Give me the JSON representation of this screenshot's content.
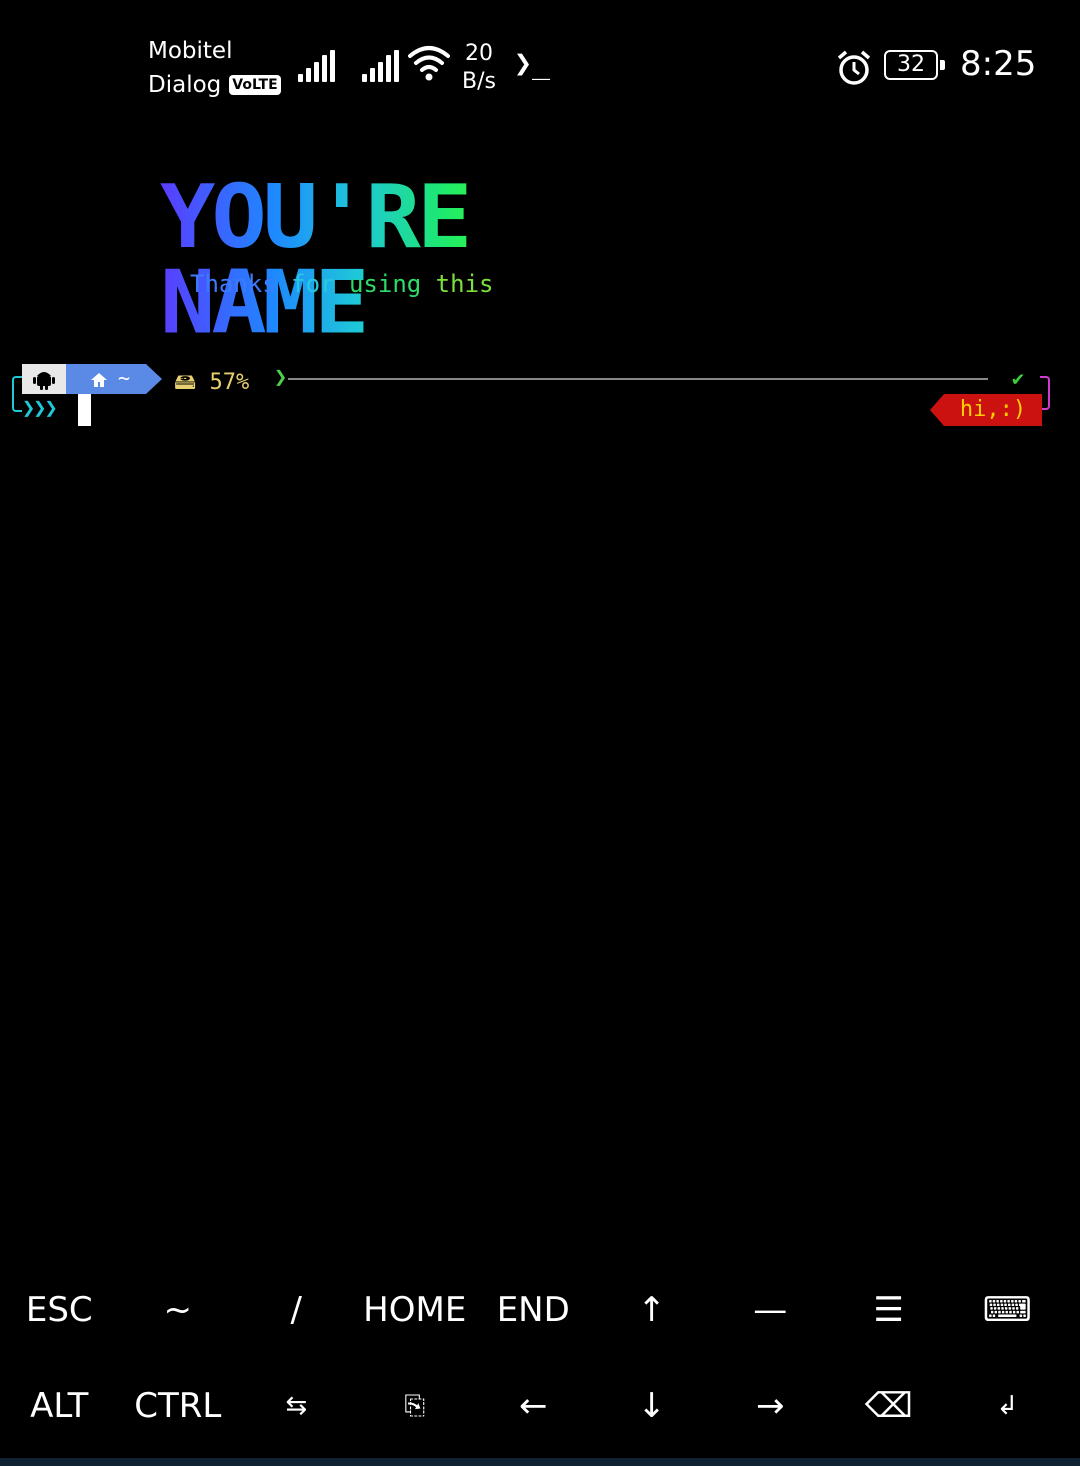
{
  "status_bar": {
    "carrier1": "Mobitel",
    "carrier2": "Dialog",
    "volte": "VoLTE",
    "speed_value": "20",
    "speed_unit": "B/s",
    "terminal_glyph": "❯_",
    "battery": "32",
    "time": "8:25"
  },
  "banner": {
    "title": "YOU'RE NAME",
    "tagline_words": [
      "Thanks",
      "for",
      "using",
      "this"
    ]
  },
  "prompt": {
    "home_segment": "~",
    "disk_icon": "🖴",
    "disk_usage": "57%",
    "chevron": "❯",
    "check": "✔",
    "arrows": "❯❯❯",
    "right_badge": "hi,:)"
  },
  "extra_keys": {
    "row1": [
      "ESC",
      "~",
      "/",
      "HOME",
      "END",
      "↑",
      "—",
      "☰",
      "⌨"
    ],
    "row2": [
      "ALT",
      "CTRL",
      "⇆",
      "⎘",
      "←",
      "↓",
      "→",
      "⌫",
      "↲"
    ]
  },
  "colors": {
    "background": "#000000",
    "prompt_home": "#5a8ae6",
    "badge": "#cc1111",
    "badge_text": "#ffd000",
    "disk": "#e8d070",
    "accent_cyan": "#1ec8d8"
  }
}
